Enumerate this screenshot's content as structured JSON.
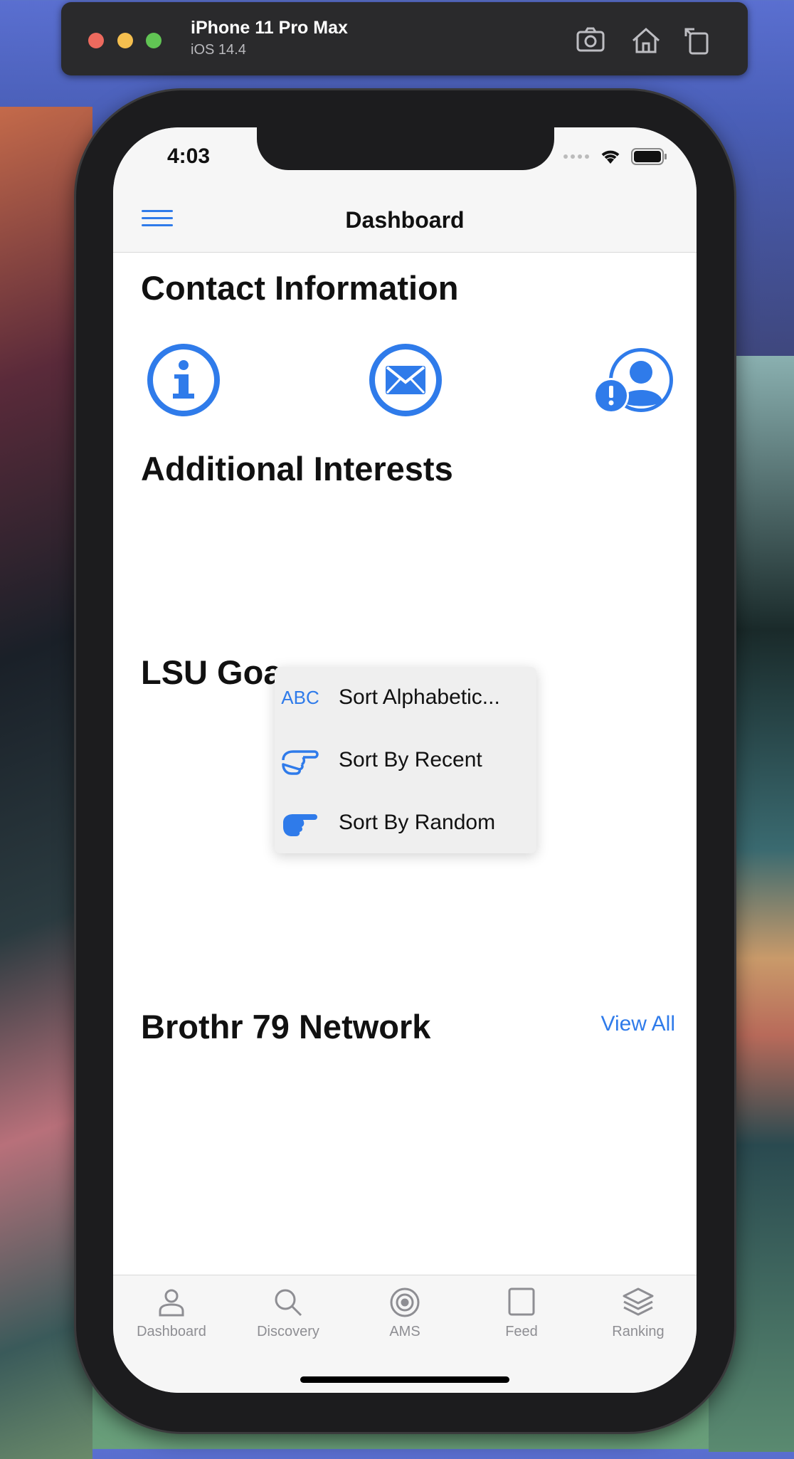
{
  "simulator": {
    "device_name": "iPhone 11 Pro Max",
    "os_version": "iOS 14.4"
  },
  "status_bar": {
    "time": "4:03"
  },
  "nav": {
    "title": "Dashboard"
  },
  "sections": {
    "contact": "Contact Information",
    "interests": "Additional Interests",
    "goals": "LSU Goa",
    "network": "Brothr 79 Network",
    "view_all": "View All"
  },
  "contact_icons": [
    "info-circle-icon",
    "envelope-circle-icon",
    "user-alert-icon"
  ],
  "popup_menu": {
    "items": [
      {
        "icon_text": "ABC",
        "icon": "abc-icon",
        "label": "Sort Alphabetic..."
      },
      {
        "icon_text": "",
        "icon": "hand-point-right-outline-icon",
        "label": "Sort By Recent"
      },
      {
        "icon_text": "",
        "icon": "hand-point-right-solid-icon",
        "label": "Sort By Random"
      }
    ]
  },
  "tabs": [
    {
      "label": "Dashboard",
      "icon": "person-icon"
    },
    {
      "label": "Discovery",
      "icon": "search-icon"
    },
    {
      "label": "AMS",
      "icon": "target-icon"
    },
    {
      "label": "Feed",
      "icon": "square-icon"
    },
    {
      "label": "Ranking",
      "icon": "layers-icon"
    }
  ],
  "colors": {
    "accent": "#2f7bea",
    "tab_inactive": "#8e8e93"
  }
}
